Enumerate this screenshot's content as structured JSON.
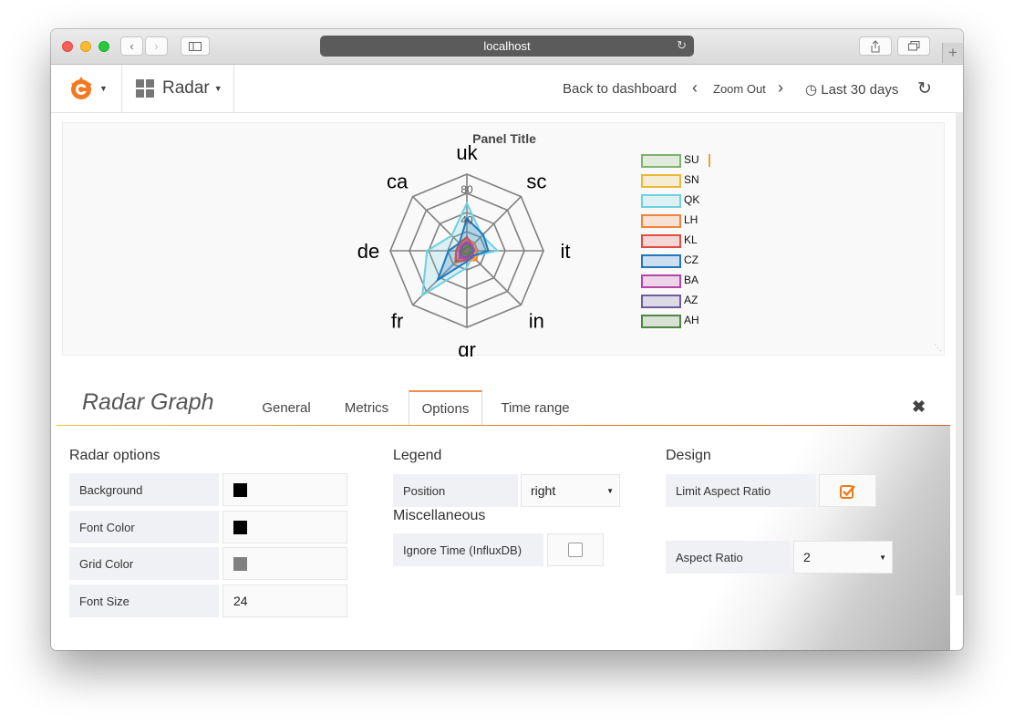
{
  "browser": {
    "url": "localhost"
  },
  "navbar": {
    "dashboard_title": "Radar",
    "back_link": "Back to dashboard",
    "zoom_out": "Zoom Out",
    "time_range": "Last 30 days"
  },
  "panel": {
    "title": "Panel Title",
    "legend": [
      {
        "label": "SU",
        "color": "#7eb26d"
      },
      {
        "label": "SN",
        "color": "#eab839"
      },
      {
        "label": "QK",
        "color": "#6ed0e0"
      },
      {
        "label": "LH",
        "color": "#ef843c"
      },
      {
        "label": "KL",
        "color": "#e24d42"
      },
      {
        "label": "CZ",
        "color": "#1f78c1"
      },
      {
        "label": "BA",
        "color": "#ba43a9"
      },
      {
        "label": "AZ",
        "color": "#705da0"
      },
      {
        "label": "AH",
        "color": "#508642"
      }
    ]
  },
  "chart_data": {
    "type": "radar",
    "title": "Panel Title",
    "axes": [
      "uk",
      "sc",
      "it",
      "in",
      "gr",
      "fr",
      "de",
      "ca"
    ],
    "radial_ticks": [
      40,
      80
    ],
    "rmax": 100,
    "grid_color": "#808080",
    "legend_position": "right",
    "series": [
      {
        "name": "SU",
        "color": "#7eb26d",
        "values": [
          8,
          6,
          6,
          5,
          6,
          5,
          6,
          6
        ]
      },
      {
        "name": "SN",
        "color": "#eab839",
        "values": [
          12,
          10,
          12,
          14,
          8,
          12,
          10,
          10
        ]
      },
      {
        "name": "QK",
        "color": "#6ed0e0",
        "values": [
          62,
          28,
          40,
          10,
          22,
          82,
          52,
          28
        ]
      },
      {
        "name": "LH",
        "color": "#ef843c",
        "values": [
          16,
          14,
          14,
          18,
          12,
          22,
          14,
          12
        ]
      },
      {
        "name": "KL",
        "color": "#e24d42",
        "values": [
          18,
          10,
          8,
          12,
          12,
          20,
          14,
          14
        ]
      },
      {
        "name": "CZ",
        "color": "#1f78c1",
        "values": [
          42,
          30,
          28,
          10,
          14,
          54,
          24,
          14
        ]
      },
      {
        "name": "BA",
        "color": "#ba43a9",
        "values": [
          12,
          10,
          10,
          8,
          10,
          14,
          10,
          10
        ]
      },
      {
        "name": "AZ",
        "color": "#705da0",
        "values": [
          10,
          8,
          8,
          6,
          8,
          10,
          8,
          8
        ]
      },
      {
        "name": "AH",
        "color": "#508642",
        "values": [
          6,
          6,
          4,
          6,
          4,
          6,
          6,
          4
        ]
      }
    ]
  },
  "editor": {
    "title": "Radar Graph",
    "tabs": [
      "General",
      "Metrics",
      "Options",
      "Time range"
    ],
    "active_tab": "Options",
    "radar_options": {
      "title": "Radar options",
      "background_label": "Background",
      "background_color": "#000000",
      "font_color_label": "Font Color",
      "font_color": "#000000",
      "grid_color_label": "Grid Color",
      "grid_color": "#808080",
      "font_size_label": "Font Size",
      "font_size_value": "24"
    },
    "legend": {
      "title": "Legend",
      "position_label": "Position",
      "position_value": "right"
    },
    "misc": {
      "title": "Miscellaneous",
      "ignore_time_label": "Ignore Time (InfluxDB)",
      "ignore_time_checked": false
    },
    "design": {
      "title": "Design",
      "limit_aspect_label": "Limit Aspect Ratio",
      "limit_aspect_checked": true,
      "aspect_ratio_label": "Aspect Ratio",
      "aspect_ratio_value": "2"
    }
  },
  "colors": {
    "accent": "#f08a4b",
    "checkbox_checked": "#eb7b18"
  }
}
